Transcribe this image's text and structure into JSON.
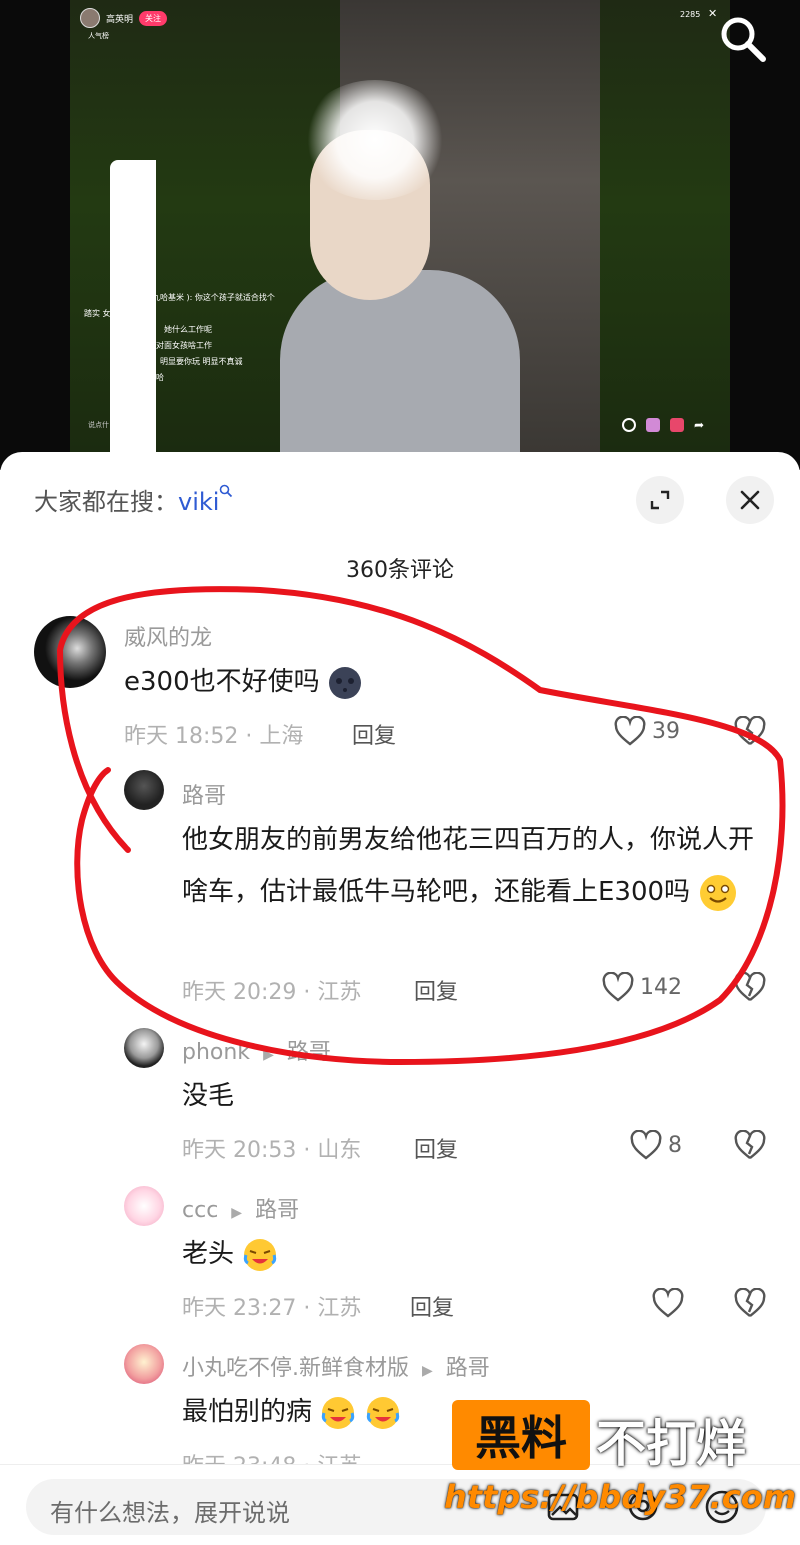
{
  "stream": {
    "host_name": "高英明",
    "follow_label": "关注",
    "popularity_label": "人气榜",
    "viewer_count": "2285",
    "close_glyph": "✕",
    "chat": [
      "十九哈基米 ): 你这个孩子就适合找个",
      "踏实 女孩。",
      "她什么工作呢",
      "对面女孩啥工作",
      "明显要你玩 明显不真诚",
      "哈"
    ],
    "chat_input": "说点什"
  },
  "sheet": {
    "search_prefix": "大家都在搜：",
    "search_keyword": "viki",
    "comment_count": "360条评论",
    "expand_icon": "expand-icon",
    "close_icon": "close-icon"
  },
  "comments": [
    {
      "user": "威风的龙",
      "text": "e300也不好使吗",
      "time": "昨天 18:52 · 上海",
      "reply": "回复",
      "likes": "39"
    },
    {
      "user": "路哥",
      "text": "他女朋友的前男友给他花三四百万的人，你说人开啥车，估计最低牛马轮吧，还能看上E300吗",
      "time": "昨天 20:29 · 江苏",
      "reply": "回复",
      "likes": "142"
    },
    {
      "user": "phonk",
      "reply_to": "路哥",
      "text": "没毛",
      "time": "昨天 20:53 · 山东",
      "reply": "回复",
      "likes": "8"
    },
    {
      "user": "ccc",
      "reply_to": "路哥",
      "text": "老头",
      "time": "昨天 23:27 · 江苏",
      "reply": "回复",
      "likes": ""
    },
    {
      "user": "小丸吃不停.新鲜食材版",
      "reply_to": "路哥",
      "text": "最怕别的病",
      "time": "昨天 23:48 · 江苏",
      "reply": "回复",
      "likes": ""
    }
  ],
  "input": {
    "placeholder": "有什么想法，展开说说"
  },
  "watermark": {
    "box": "黑料",
    "text": "不打烊",
    "url": "https://bbdy37.com"
  },
  "colors": {
    "annotation": "#e8141c",
    "keyword": "#2f5bd3",
    "watermark": "#ff8a00"
  }
}
